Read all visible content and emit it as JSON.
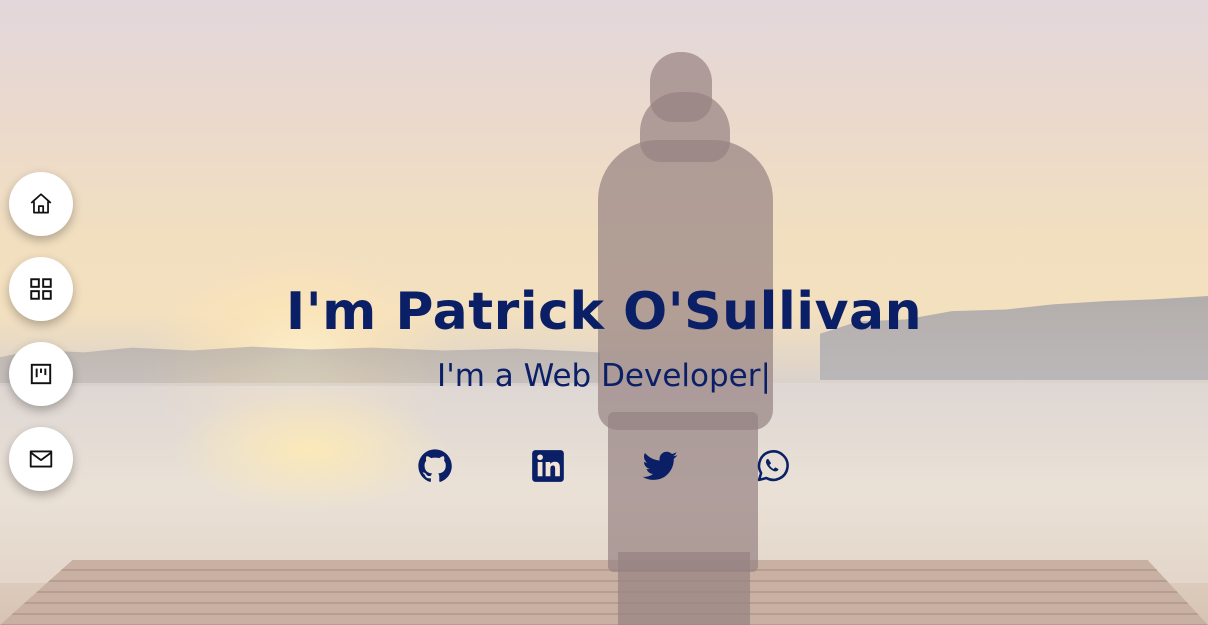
{
  "hero": {
    "name_heading": "I'm Patrick O'Sullivan",
    "subtitle_prefix": "I'm a",
    "subtitle_role": "Web Developer",
    "cursor": "|"
  },
  "sidenav": [
    {
      "icon": "home-icon"
    },
    {
      "icon": "grid-icon"
    },
    {
      "icon": "board-icon"
    },
    {
      "icon": "mail-icon"
    }
  ],
  "social": [
    {
      "icon": "github-icon"
    },
    {
      "icon": "linkedin-icon"
    },
    {
      "icon": "twitter-icon"
    },
    {
      "icon": "whatsapp-icon"
    }
  ],
  "colors": {
    "text": "#0a1f66",
    "nav_bg": "#ffffff"
  }
}
